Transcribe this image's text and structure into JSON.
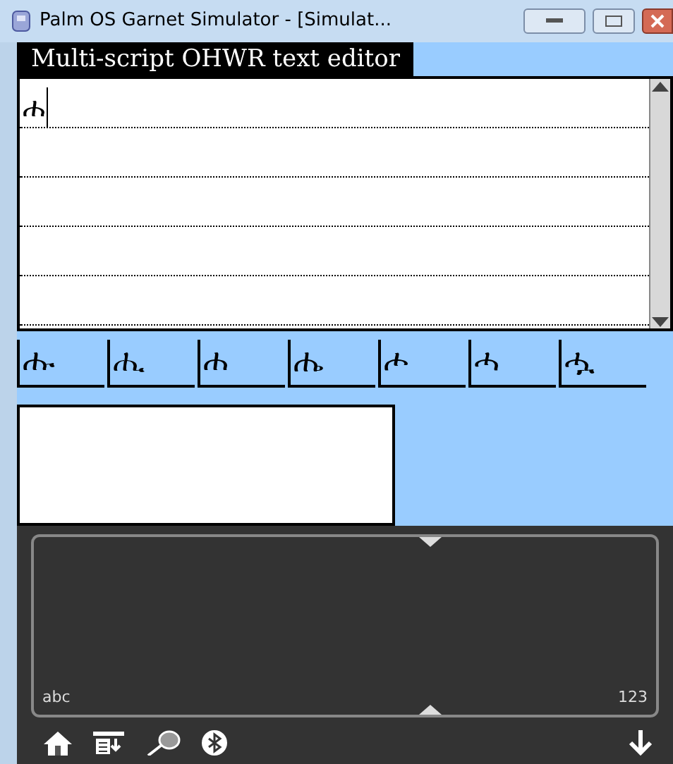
{
  "window": {
    "title": "Palm OS Garnet Simulator - [Simulat..."
  },
  "form": {
    "title": "Multi-script OHWR text editor"
  },
  "editor": {
    "text": "ሐ"
  },
  "candidates": [
    "ሑ",
    "ሒ",
    "ሐ",
    "ሔ",
    "ሖ",
    "ሓ",
    "ሗ"
  ],
  "graffiti": {
    "letters_label": "abc",
    "numbers_label": "123"
  }
}
